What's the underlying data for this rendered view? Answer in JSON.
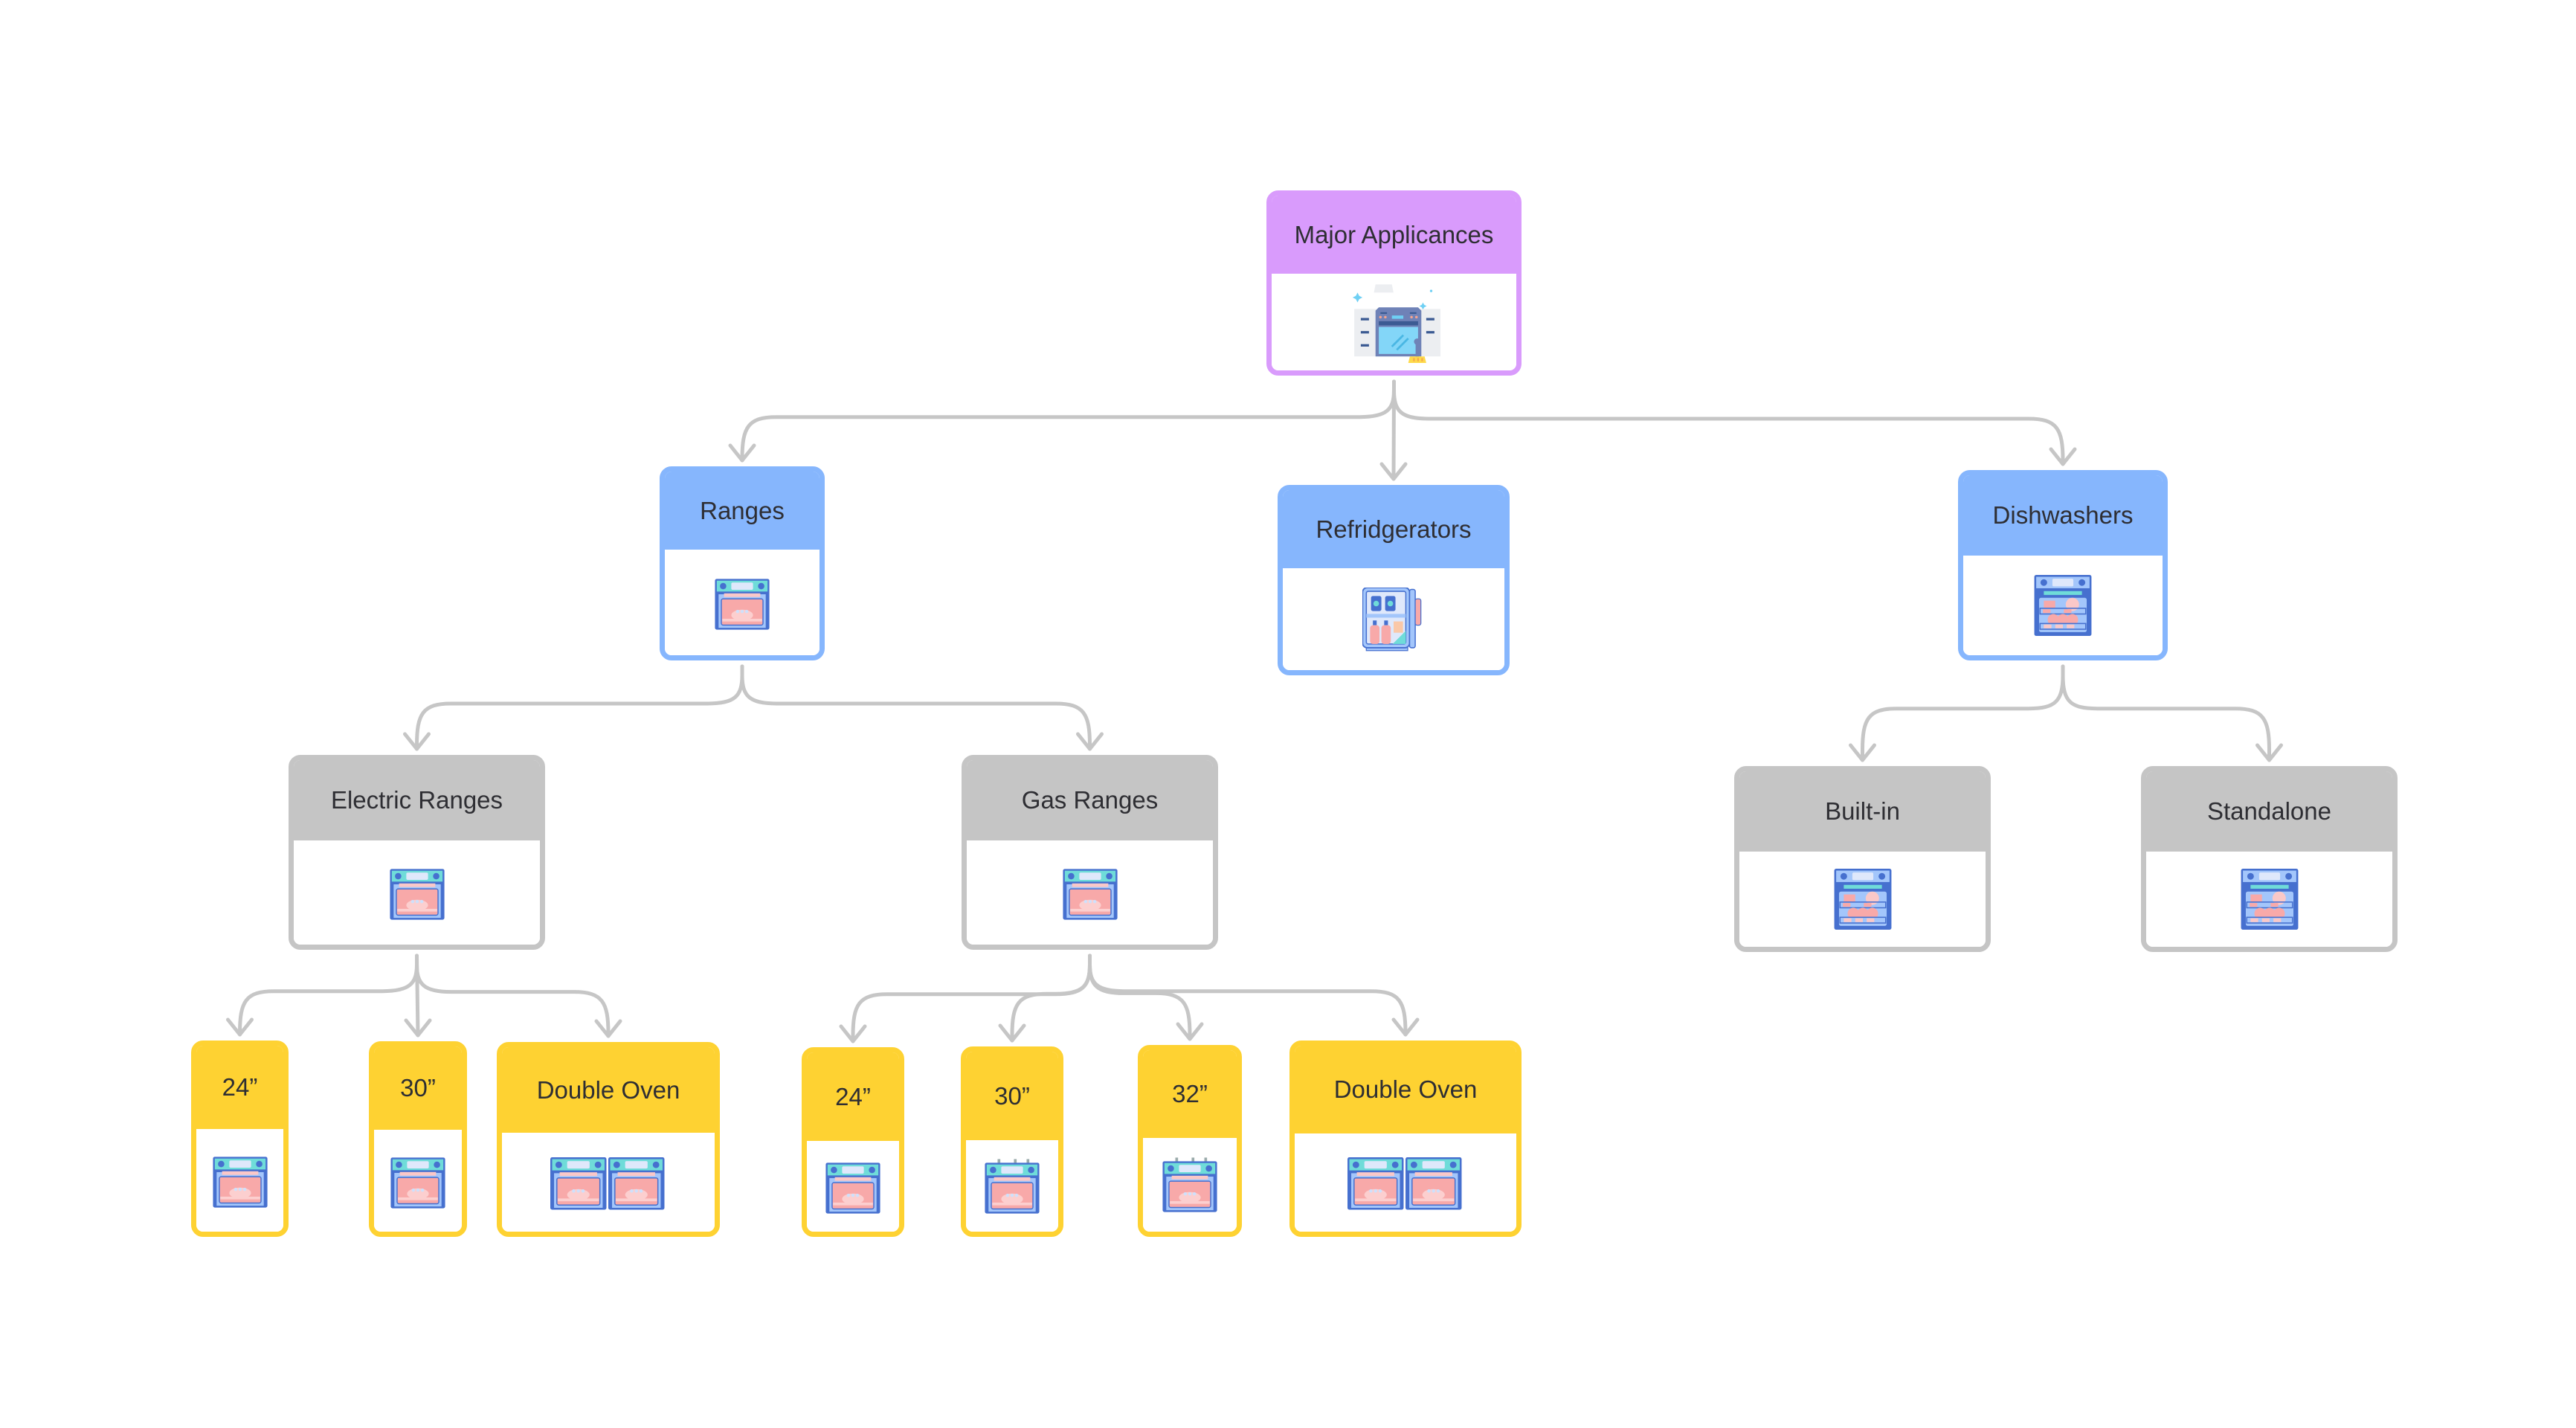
{
  "diagram": {
    "title": "Major Applicances",
    "colors": {
      "root": "#d99bfc",
      "category": "#86b6fd",
      "subcategory": "#c5c5c5",
      "leaf": "#fed232",
      "connector": "#c6c6c6",
      "text": "#2e2e33"
    },
    "nodes": {
      "root": {
        "label": "Major Applicances",
        "icon": "kitchen-cleaning-icon"
      },
      "ranges": {
        "label": "Ranges",
        "icon": "oven-icon"
      },
      "refrigerators": {
        "label": "Refridgerators",
        "icon": "mini-fridge-icon"
      },
      "dishwashers": {
        "label": "Dishwashers",
        "icon": "dishwasher-icon"
      },
      "electric_ranges": {
        "label": "Electric Ranges",
        "icon": "oven-icon"
      },
      "gas_ranges": {
        "label": "Gas Ranges",
        "icon": "oven-icon"
      },
      "built_in": {
        "label": "Built-in",
        "icon": "dishwasher-icon"
      },
      "standalone": {
        "label": "Standalone",
        "icon": "dishwasher-icon"
      },
      "electric_24": {
        "label": "24”",
        "icon": "oven-icon"
      },
      "electric_30": {
        "label": "30”",
        "icon": "oven-icon"
      },
      "electric_double": {
        "label": "Double Oven",
        "icon": "double-oven-icon"
      },
      "gas_24": {
        "label": "24”",
        "icon": "oven-icon"
      },
      "gas_30": {
        "label": "30”",
        "icon": "gas-oven-icon"
      },
      "gas_32": {
        "label": "32”",
        "icon": "gas-oven-icon"
      },
      "gas_double": {
        "label": "Double Oven",
        "icon": "double-oven-icon"
      }
    },
    "edges": [
      [
        "root",
        "ranges"
      ],
      [
        "root",
        "refrigerators"
      ],
      [
        "root",
        "dishwashers"
      ],
      [
        "ranges",
        "electric_ranges"
      ],
      [
        "ranges",
        "gas_ranges"
      ],
      [
        "dishwashers",
        "built_in"
      ],
      [
        "dishwashers",
        "standalone"
      ],
      [
        "electric_ranges",
        "electric_24"
      ],
      [
        "electric_ranges",
        "electric_30"
      ],
      [
        "electric_ranges",
        "electric_double"
      ],
      [
        "gas_ranges",
        "gas_24"
      ],
      [
        "gas_ranges",
        "gas_30"
      ],
      [
        "gas_ranges",
        "gas_32"
      ],
      [
        "gas_ranges",
        "gas_double"
      ]
    ]
  }
}
